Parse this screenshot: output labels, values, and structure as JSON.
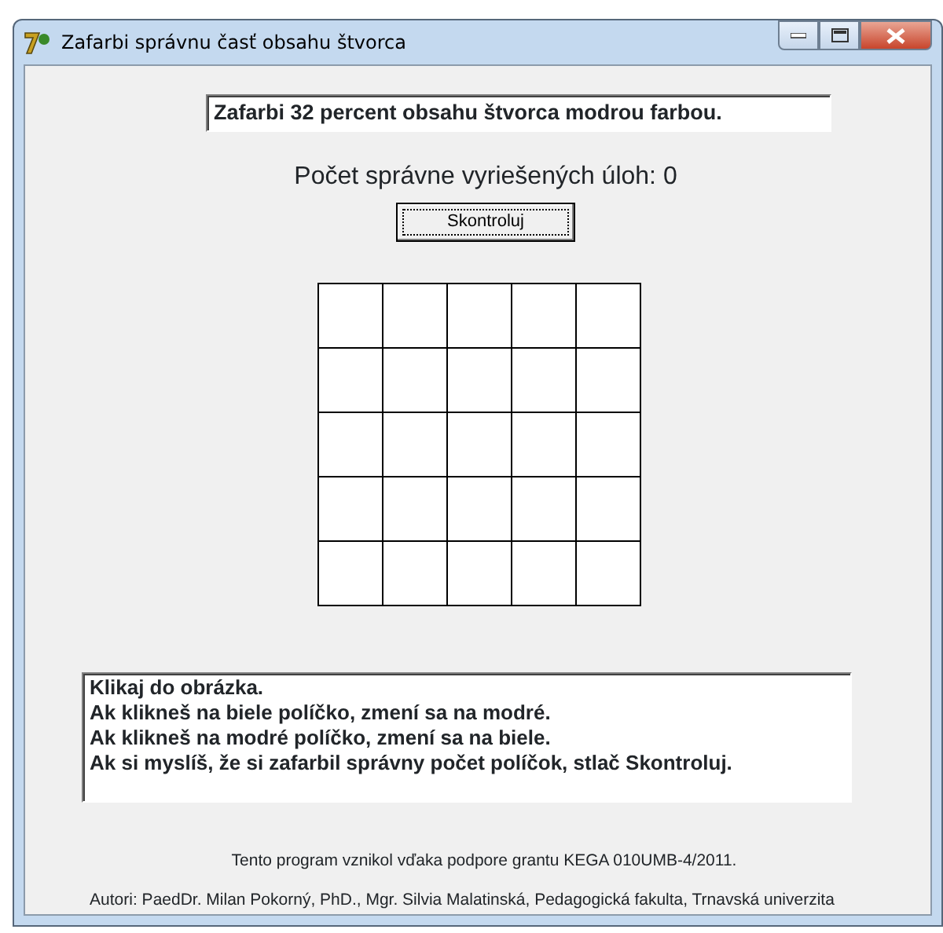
{
  "window": {
    "title": "Zafarbi správnu časť obsahu štvorca"
  },
  "task": "Zafarbi 32 percent obsahu štvorca modrou farbou.",
  "score": "Počet správne vyriešených úloh: 0",
  "check_button": "Skontroluj",
  "grid": [
    [
      {
        "filled": false
      },
      {
        "filled": false
      },
      {
        "filled": false
      },
      {
        "filled": false
      },
      {
        "filled": false
      }
    ],
    [
      {
        "filled": false
      },
      {
        "filled": false
      },
      {
        "filled": false
      },
      {
        "filled": false
      },
      {
        "filled": false
      }
    ],
    [
      {
        "filled": false
      },
      {
        "filled": false
      },
      {
        "filled": false
      },
      {
        "filled": false
      },
      {
        "filled": false
      }
    ],
    [
      {
        "filled": false
      },
      {
        "filled": false
      },
      {
        "filled": false
      },
      {
        "filled": false
      },
      {
        "filled": false
      }
    ],
    [
      {
        "filled": false
      },
      {
        "filled": false
      },
      {
        "filled": false
      },
      {
        "filled": false
      },
      {
        "filled": false
      }
    ]
  ],
  "instructions": [
    "Klikaj do obrázka.",
    "Ak klikneš na biele políčko, zmení sa na modré.",
    "Ak klikneš na modré políčko, zmení sa na biele.",
    "Ak si myslíš, že si zafarbil správny počet políčok, stlač Skontroluj."
  ],
  "footer": [
    "Tento program vznikol vďaka podpore grantu KEGA 010UMB-4/2011.",
    "Autori: PaedDr. Milan Pokorný, PhD., Mgr. Silvia Malatinská, Pedagogická fakulta, Trnavská univerzita"
  ]
}
